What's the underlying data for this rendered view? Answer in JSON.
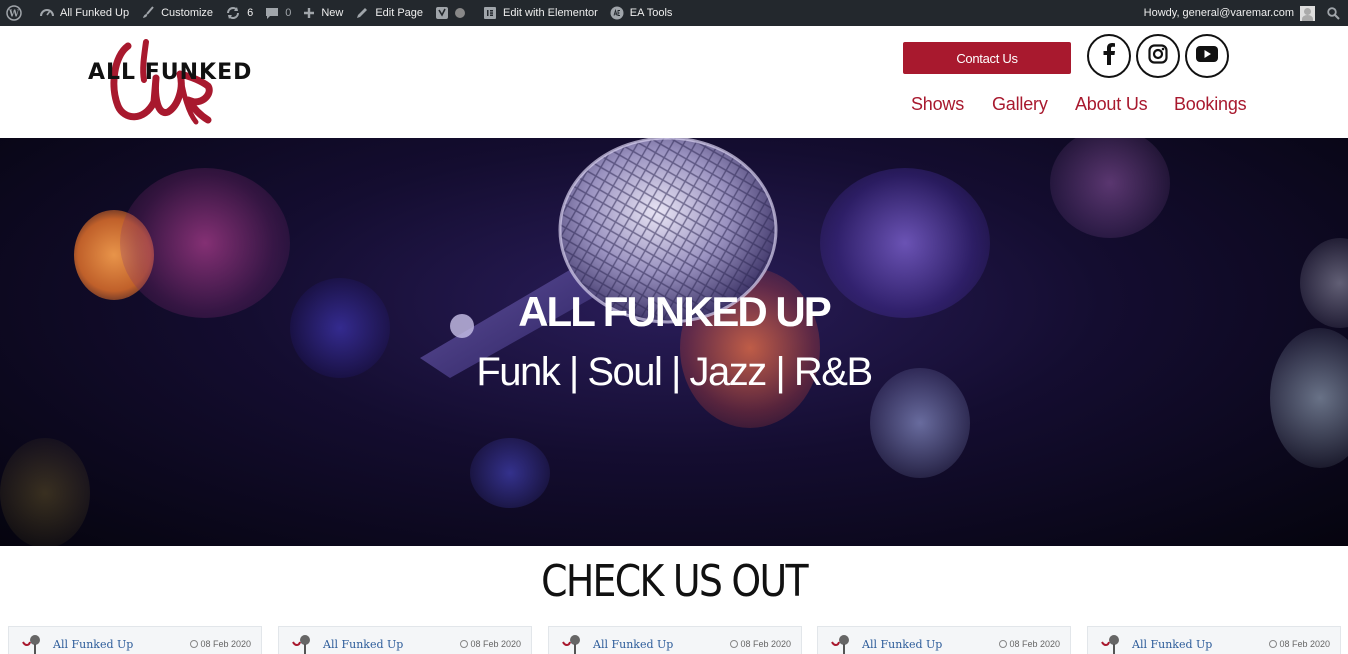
{
  "adminbar": {
    "site_name": "All Funked Up",
    "customize": "Customize",
    "updates_count": "6",
    "comments_count": "0",
    "new": "New",
    "edit_page": "Edit Page",
    "elementor": "Edit with Elementor",
    "ea_tools": "EA Tools",
    "howdy": "Howdy, general@varemar.com"
  },
  "header": {
    "logo_text": "ALL FUNKED",
    "contact_label": "Contact Us",
    "nav": [
      "Shows",
      "Gallery",
      "About Us",
      "Bookings"
    ],
    "brand_color": "#a8192e"
  },
  "hero": {
    "title": "ALL FUNKED UP",
    "subtitle": "Funk | Soul | Jazz | R&B"
  },
  "section": {
    "title": "CHECK US OUT"
  },
  "cards": [
    {
      "name": "All Funked Up",
      "date": "08 Feb 2020"
    },
    {
      "name": "All Funked Up",
      "date": "08 Feb 2020"
    },
    {
      "name": "All Funked Up",
      "date": "08 Feb 2020"
    },
    {
      "name": "All Funked Up",
      "date": "08 Feb 2020"
    },
    {
      "name": "All Funked Up",
      "date": "08 Feb 2020"
    }
  ]
}
